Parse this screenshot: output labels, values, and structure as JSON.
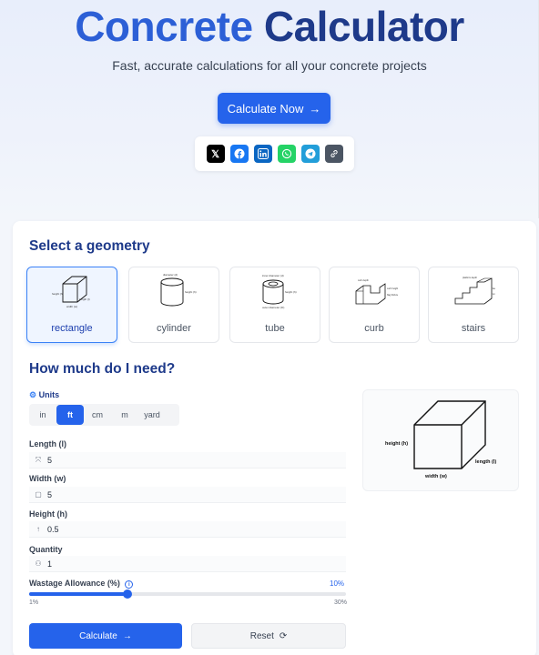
{
  "hero": {
    "title_a": "Concrete",
    "title_b": "Calculator",
    "subtitle": "Fast, accurate calculations for all your concrete projects",
    "cta_label": "Calculate Now",
    "cta_arrow": "→",
    "share_icons": [
      "x-icon",
      "facebook-icon",
      "linkedin-icon",
      "whatsapp-icon",
      "telegram-icon",
      "link-icon"
    ]
  },
  "geometry": {
    "heading": "Select a geometry",
    "items": [
      {
        "label": "rectangle",
        "active": true
      },
      {
        "label": "cylinder",
        "active": false
      },
      {
        "label": "tube",
        "active": false
      },
      {
        "label": "curb",
        "active": false
      },
      {
        "label": "stairs",
        "active": false
      }
    ]
  },
  "form": {
    "heading": "How much do I need?",
    "units_label": "Units",
    "units": [
      "in",
      "ft",
      "cm",
      "m",
      "yard"
    ],
    "selected_unit": "ft",
    "length_label": "Length (l)",
    "length_value": "5",
    "width_label": "Width (w)",
    "width_value": "5",
    "height_label": "Height (h)",
    "height_value": "0.5",
    "quantity_label": "Quantity",
    "quantity_value": "1",
    "wastage_label": "Wastage Allowance (%)",
    "wastage_value": "10%",
    "wastage_fraction": 0.31,
    "wastage_min": "1%",
    "wastage_max": "30%",
    "calculate_label": "Calculate",
    "calculate_arrow": "→",
    "reset_label": "Reset"
  },
  "preview": {
    "height_label": "height (h)",
    "length_label": "length (l)",
    "width_label": "width (w)"
  },
  "colors": {
    "accent": "#2563eb",
    "title_blue": "#2c5fd6",
    "title_dark": "#1e3a8a"
  }
}
